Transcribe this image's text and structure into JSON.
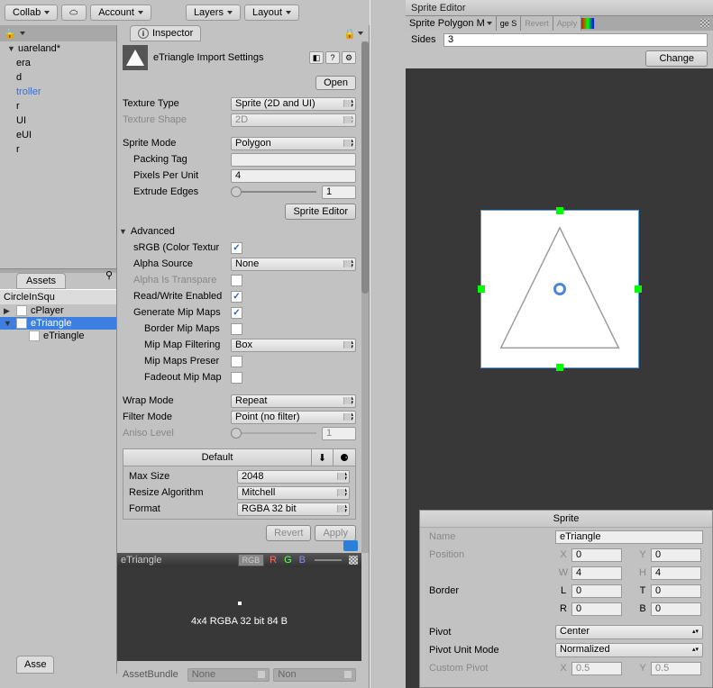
{
  "toolbar": {
    "collab": "Collab",
    "account": "Account",
    "layers": "Layers",
    "layout": "Layout"
  },
  "hierarchy": {
    "scene": "uareland*",
    "items": [
      "era",
      "d",
      "troller",
      "r",
      "UI",
      "eUI",
      "r"
    ]
  },
  "project": {
    "tab": "Assets",
    "crumb": "CircleInSqu",
    "items": [
      {
        "name": "cPlayer",
        "sel": false,
        "expandable": true
      },
      {
        "name": "eTriangle",
        "sel": true,
        "expandable": true
      },
      {
        "name": "eTriangle",
        "sel": false,
        "expandable": false
      }
    ],
    "asse": "Asse"
  },
  "inspector": {
    "tab": "Inspector",
    "title": "eTriangle Import Settings",
    "open": "Open",
    "textureType": {
      "lbl": "Texture Type",
      "val": "Sprite (2D and UI)"
    },
    "textureShape": {
      "lbl": "Texture Shape",
      "val": "2D"
    },
    "spriteMode": {
      "lbl": "Sprite Mode",
      "val": "Polygon"
    },
    "packingTag": {
      "lbl": "Packing Tag",
      "val": ""
    },
    "pixelsPerUnit": {
      "lbl": "Pixels Per Unit",
      "val": "4"
    },
    "extrudeEdges": {
      "lbl": "Extrude Edges",
      "val": "1"
    },
    "spriteEditorBtn": "Sprite Editor",
    "advanced": "Advanced",
    "srgb": {
      "lbl": "sRGB (Color Textur",
      "chk": true
    },
    "alphaSource": {
      "lbl": "Alpha Source",
      "val": "None"
    },
    "alphaTransp": {
      "lbl": "Alpha Is Transpare",
      "chk": false
    },
    "readWrite": {
      "lbl": "Read/Write Enabled",
      "chk": true
    },
    "genMipMaps": {
      "lbl": "Generate Mip Maps",
      "chk": true
    },
    "borderMipMaps": {
      "lbl": "Border Mip Maps",
      "chk": false
    },
    "mipMapFilter": {
      "lbl": "Mip Map Filtering",
      "val": "Box"
    },
    "mipMapsPreserve": {
      "lbl": "Mip Maps Preser",
      "chk": false
    },
    "fadeoutMipMaps": {
      "lbl": "Fadeout Mip Map",
      "chk": false
    },
    "wrapMode": {
      "lbl": "Wrap Mode",
      "val": "Repeat"
    },
    "filterMode": {
      "lbl": "Filter Mode",
      "val": "Point (no filter)"
    },
    "anisoLevel": {
      "lbl": "Aniso Level",
      "val": "1"
    },
    "default": "Default",
    "maxSize": {
      "lbl": "Max Size",
      "val": "2048"
    },
    "resizeAlgo": {
      "lbl": "Resize Algorithm",
      "val": "Mitchell"
    },
    "format": {
      "lbl": "Format",
      "val": "RGBA 32 bit"
    },
    "revert": "Revert",
    "apply": "Apply"
  },
  "preview": {
    "title": "eTriangle",
    "rgb": "RGB",
    "info": "4x4  RGBA 32 bit  84 B",
    "assetBundle": "AssetBundle",
    "none": "None"
  },
  "spriteEditor": {
    "title": "Sprite Editor",
    "polyMenu": "Sprite Polygon M",
    "geS": "ge S",
    "revert": "Revert",
    "apply": "Apply",
    "sides": {
      "lbl": "Sides",
      "val": "3"
    },
    "change": "Change"
  },
  "spritePanel": {
    "title": "Sprite",
    "name": {
      "lbl": "Name",
      "val": "eTriangle"
    },
    "position": {
      "lbl": "Position",
      "x": "0",
      "y": "0",
      "w": "4",
      "h": "4"
    },
    "border": {
      "lbl": "Border",
      "l": "0",
      "t": "0",
      "r": "0",
      "b": "0"
    },
    "pivot": {
      "lbl": "Pivot",
      "val": "Center"
    },
    "pivotUnitMode": {
      "lbl": "Pivot Unit Mode",
      "val": "Normalized"
    },
    "customPivot": {
      "lbl": "Custom Pivot",
      "x": "0.5",
      "y": "0.5"
    }
  }
}
